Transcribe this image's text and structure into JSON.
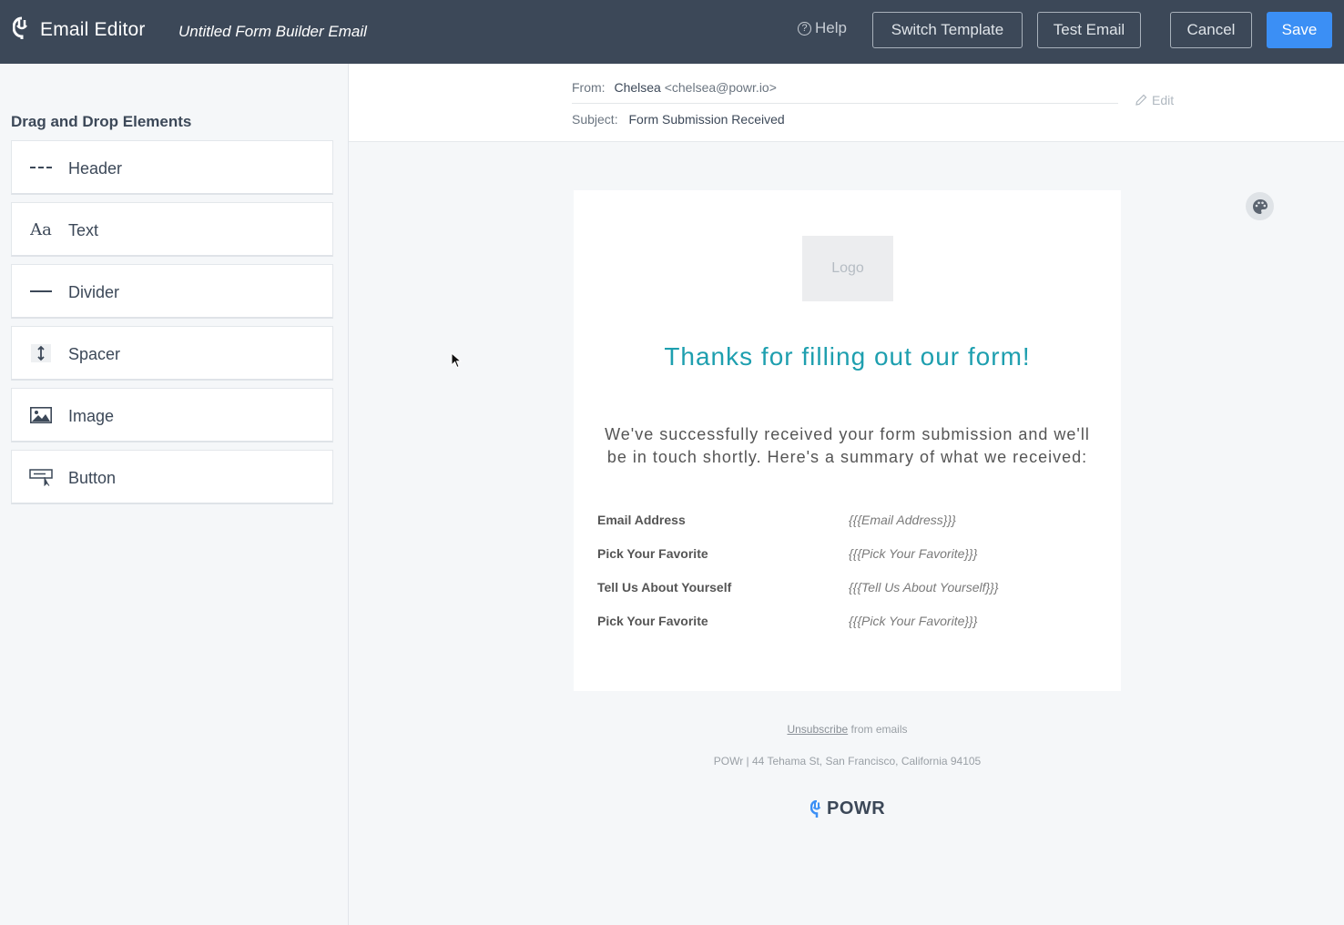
{
  "topbar": {
    "app_title": "Email Editor",
    "doc_title": "Untitled Form Builder Email",
    "help_label": "Help",
    "switch_template_label": "Switch Template",
    "test_email_label": "Test Email",
    "cancel_label": "Cancel",
    "save_label": "Save",
    "save_color": "#3b8ff5",
    "bar_color": "#3c4858"
  },
  "sidebar": {
    "title": "Drag and Drop Elements",
    "items": [
      {
        "label": "Header",
        "icon": "header-icon"
      },
      {
        "label": "Text",
        "icon": "text-icon",
        "glyph": "Aa"
      },
      {
        "label": "Divider",
        "icon": "divider-icon"
      },
      {
        "label": "Spacer",
        "icon": "spacer-icon"
      },
      {
        "label": "Image",
        "icon": "image-icon"
      },
      {
        "label": "Button",
        "icon": "button-icon"
      }
    ]
  },
  "mail_header": {
    "from_label": "From:",
    "from_name": "Chelsea",
    "from_email": "<chelsea@powr.io>",
    "subject_label": "Subject:",
    "subject_value": "Form Submission Received",
    "edit_label": "Edit"
  },
  "email": {
    "logo_placeholder": "Logo",
    "heading": "Thanks for filling out our form!",
    "heading_color": "#1e9faf",
    "body": "We've successfully received your form submission and we'll be in touch shortly. Here's a summary of what we received:",
    "fields": [
      {
        "label": "Email Address",
        "value": "{{{Email Address}}}"
      },
      {
        "label": "Pick Your Favorite",
        "value": "{{{Pick Your Favorite}}}"
      },
      {
        "label": "Tell Us About Yourself",
        "value": "{{{Tell Us About Yourself}}}"
      },
      {
        "label": "Pick Your Favorite",
        "value": "{{{Pick Your Favorite}}}"
      }
    ]
  },
  "footer": {
    "unsubscribe_link": "Unsubscribe",
    "unsubscribe_rest": " from emails",
    "address": "POWr | 44 Tehama St, San Francisco, California 94105",
    "brand": "POWR"
  }
}
